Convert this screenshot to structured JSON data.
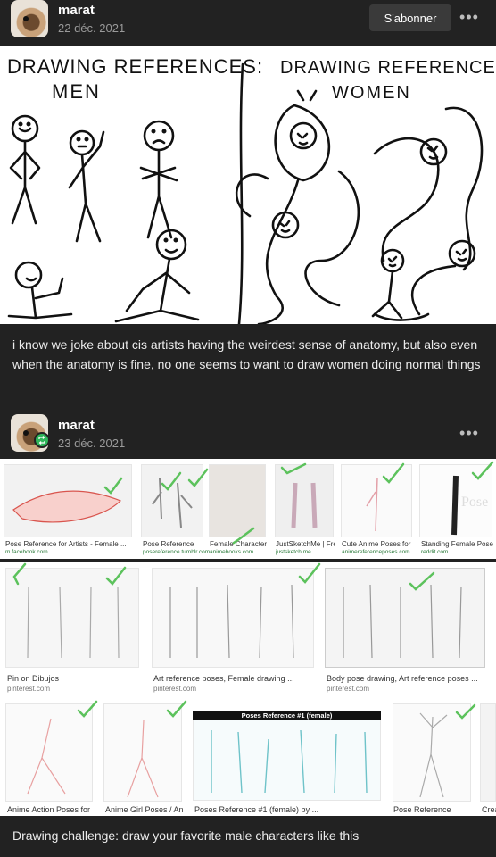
{
  "posts": [
    {
      "author": "marat",
      "date": "22 déc. 2021",
      "follow_label": "S'abonner",
      "more_icon": "more-horizontal-icon",
      "comic": {
        "left_title_line1": "DRAWING REFERENCES:",
        "left_title_line2": "MEN",
        "right_title_line1": "DRAWING REFERENCES:",
        "right_title_line2": "WOMEN"
      },
      "caption": "i know we joke about cis artists having the weirdest sense of anatomy, but also even when the anatomy is fine, no one seems to want to draw women doing normal things"
    },
    {
      "author": "marat",
      "date": "23 déc. 2021",
      "badge_icon": "reblog-icon",
      "more_icon": "more-horizontal-icon",
      "search_results": {
        "row1": [
          {
            "title": "Pose Reference for Artists - Female ...",
            "source": "m.facebook.com"
          },
          {
            "title": "Pose Reference",
            "source": "posereference.tumblr.com"
          },
          {
            "title": "Female Character Pose...",
            "source": "animebooks.com"
          },
          {
            "title": "JustSketchMe | Free in...",
            "source": "justsketch.me"
          },
          {
            "title": "Cute Anime Poses for Drawi...",
            "source": "animereferenceposes.com"
          },
          {
            "title": "Standing Female Pose Refer...",
            "source": "reddit.com"
          }
        ],
        "row2": [
          {
            "title": "Pin on Dibujos",
            "source": "pinterest.com"
          },
          {
            "title": "Art reference poses, Female drawing ...",
            "source": "pinterest.com"
          },
          {
            "title": "Body pose drawing, Art reference poses ...",
            "source": "pinterest.com"
          }
        ],
        "row3": [
          {
            "title": "Anime Action Poses for D..."
          },
          {
            "title": "Anime Girl Poses / Ani..."
          },
          {
            "title": "Poses Reference #1 (female) by ..."
          },
          {
            "title": "Pose Reference"
          },
          {
            "title": "Crea"
          }
        ],
        "watermark": "Pose Gallery",
        "poses_banner": "Poses Reference #1 (female)"
      },
      "caption": "Drawing challenge: draw your favorite male characters like this"
    }
  ],
  "colors": {
    "background": "#222222",
    "check_green": "#5cc25c",
    "reblog_green": "#2fb65a"
  }
}
